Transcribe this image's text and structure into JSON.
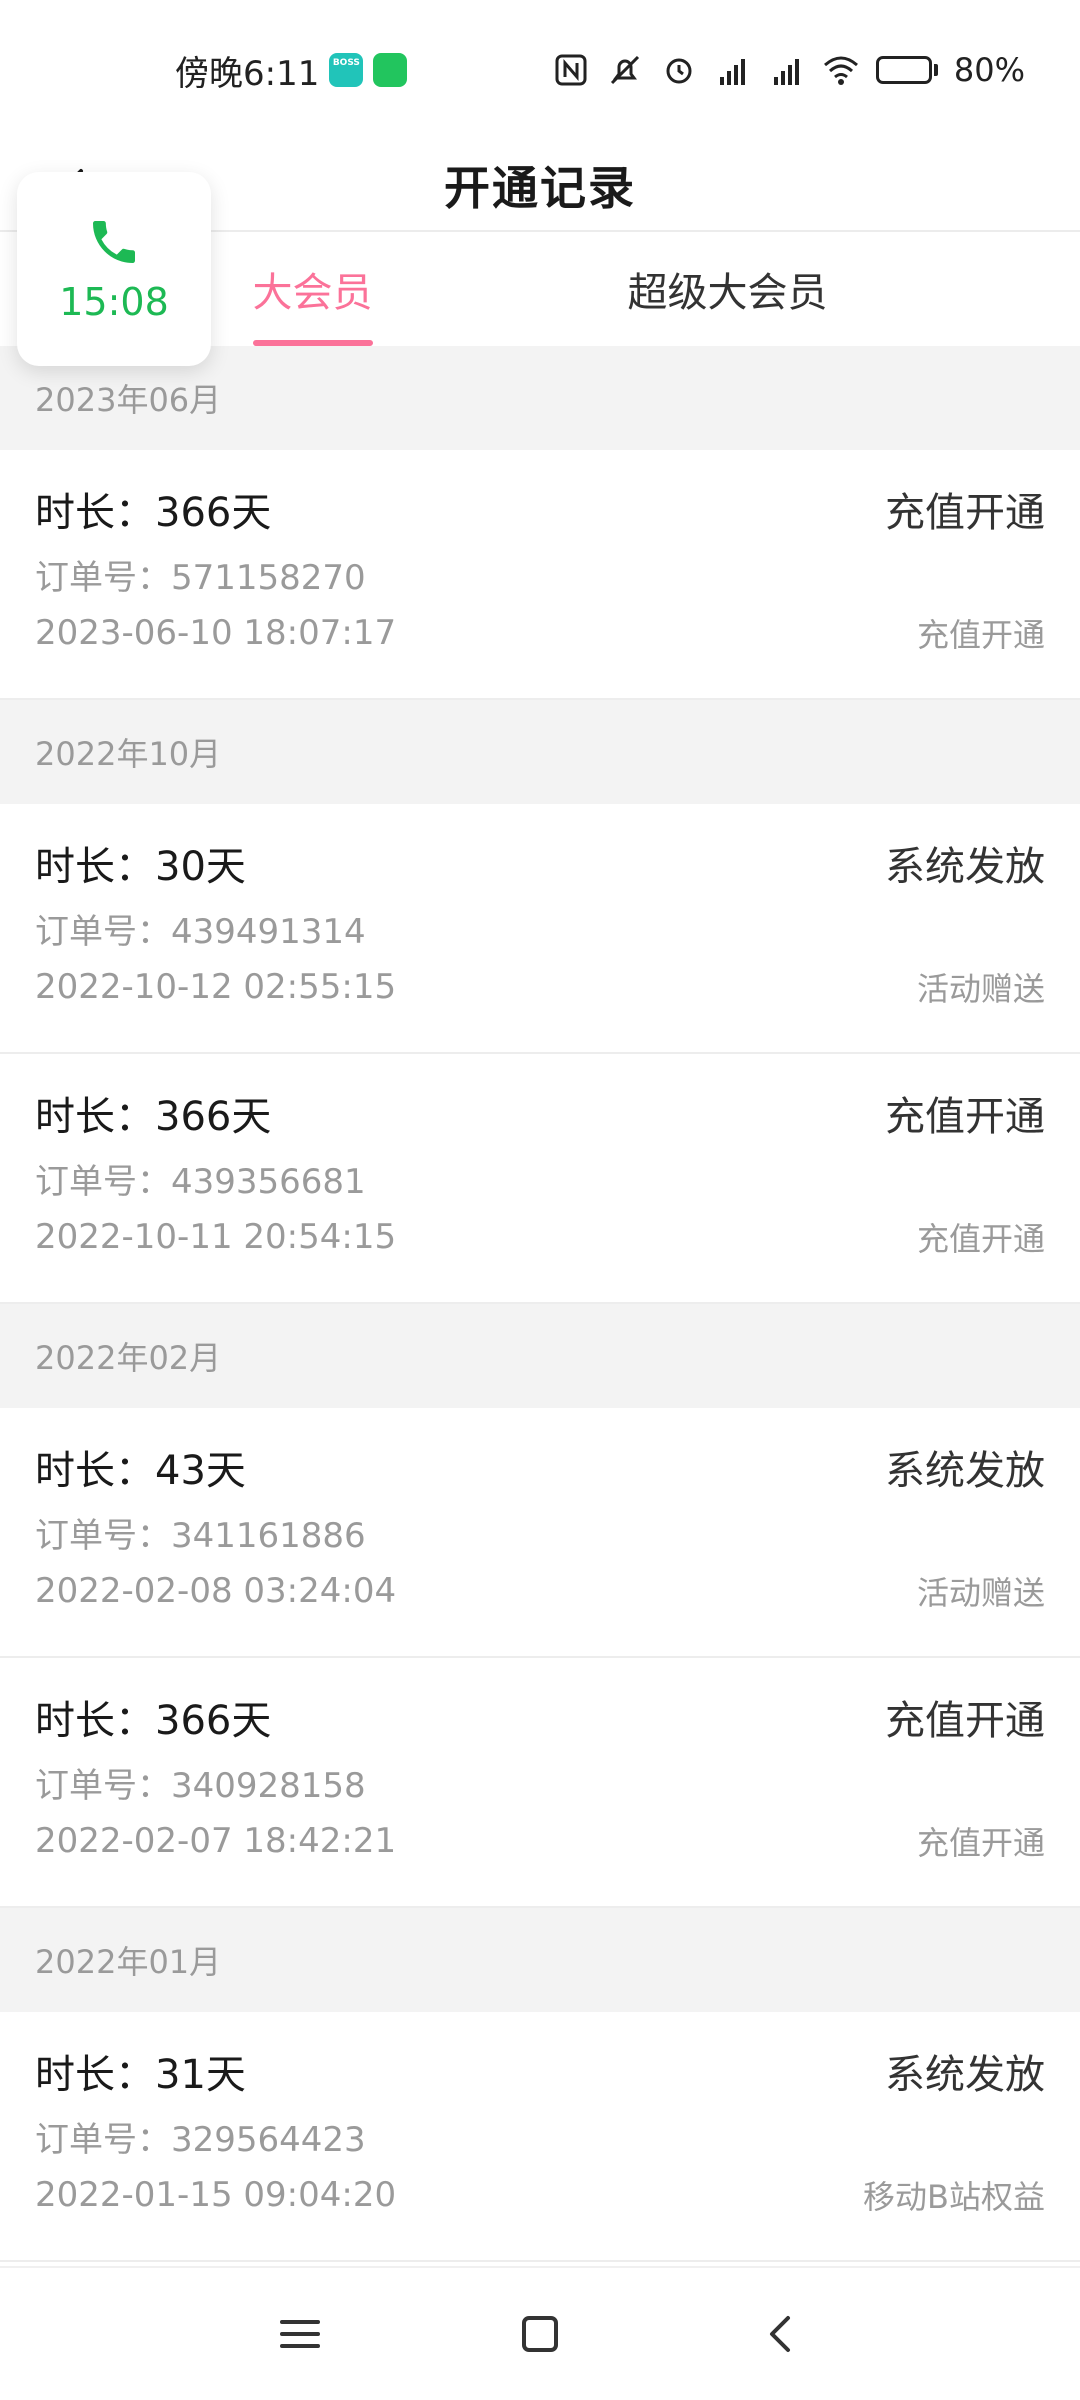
{
  "status_bar": {
    "time": "傍晚6:11",
    "boss_label": "BOSS\n直聘",
    "battery": "80%",
    "battery_level": 0.8
  },
  "header": {
    "title": "开通记录"
  },
  "call_widget": {
    "time": "15:08"
  },
  "tabs": [
    {
      "label": "大会员",
      "active": true
    },
    {
      "label": "超级大会员",
      "active": false
    }
  ],
  "sections": [
    {
      "month": "2023年06月",
      "records": [
        {
          "duration": "时长：366天",
          "type": "充值开通",
          "order": "订单号：571158270",
          "datetime": "2023-06-10 18:07:17",
          "source": "充值开通"
        }
      ]
    },
    {
      "month": "2022年10月",
      "records": [
        {
          "duration": "时长：30天",
          "type": "系统发放",
          "order": "订单号：439491314",
          "datetime": "2022-10-12 02:55:15",
          "source": "活动赠送"
        },
        {
          "duration": "时长：366天",
          "type": "充值开通",
          "order": "订单号：439356681",
          "datetime": "2022-10-11 20:54:15",
          "source": "充值开通"
        }
      ]
    },
    {
      "month": "2022年02月",
      "records": [
        {
          "duration": "时长：43天",
          "type": "系统发放",
          "order": "订单号：341161886",
          "datetime": "2022-02-08 03:24:04",
          "source": "活动赠送"
        },
        {
          "duration": "时长：366天",
          "type": "充值开通",
          "order": "订单号：340928158",
          "datetime": "2022-02-07 18:42:21",
          "source": "充值开通"
        }
      ]
    },
    {
      "month": "2022年01月",
      "records": [
        {
          "duration": "时长：31天",
          "type": "系统发放",
          "order": "订单号：329564423",
          "datetime": "2022-01-15 09:04:20",
          "source": "移动B站权益"
        }
      ]
    }
  ],
  "colors": {
    "accent": "#fb7299",
    "call_green": "#1db954",
    "section_bg": "#f3f3f3",
    "muted_text": "#9a9a9a"
  },
  "icons": {
    "back": "chevron-left-icon",
    "call": "phone-icon",
    "nav_menu": "menu-icon",
    "nav_home": "square-home-icon",
    "nav_back": "nav-back-icon"
  }
}
